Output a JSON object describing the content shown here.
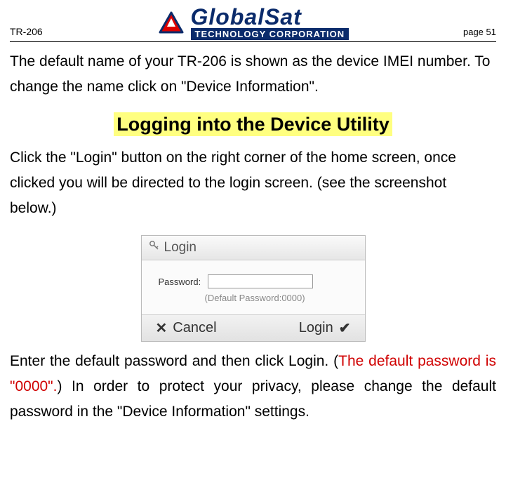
{
  "header": {
    "doc_id": "TR-206",
    "logo_brand": "GlobalSat",
    "logo_sub": "TECHNOLOGY CORPORATION",
    "page_num": "page 51"
  },
  "intro_para": "The default name of your TR-206 is shown as the device IMEI number. To change the name click on \"Device Information\".",
  "section_title": "Logging into the Device Utility",
  "login_para": "Click the \"Login\" button on the right corner of the home screen, once clicked you will be directed to the login screen. (see the screenshot below.)",
  "screenshot": {
    "title": "Login",
    "password_label": "Password:",
    "password_value": "",
    "hint": "(Default Password:0000)",
    "cancel_label": "Cancel",
    "login_label": "Login"
  },
  "final_pre": "Enter the default password and then click Login. (",
  "final_red": "The default password is \"0000\".",
  "final_post": ") In order to protect your privacy, please change the default password in the \"Device Information\" settings."
}
